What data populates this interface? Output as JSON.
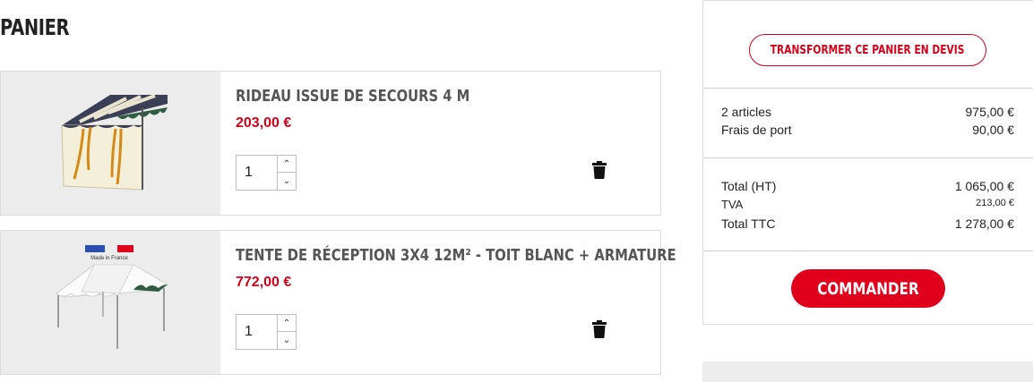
{
  "page": {
    "title": "PANIER"
  },
  "cart": {
    "items": [
      {
        "name": "RIDEAU ISSUE DE SECOURS 4 M",
        "price": "203,00 €",
        "quantity": "1",
        "image_icon": "curtain-tent-image",
        "delete_icon": "trash-icon"
      },
      {
        "name": "TENTE DE RÉCEPTION 3X4 12M² - TOIT BLANC + ARMATURE",
        "price": "772,00 €",
        "quantity": "1",
        "image_icon": "reception-tent-image",
        "badge_text": "Made in France",
        "delete_icon": "trash-icon"
      }
    ],
    "qty_up_glyph": "⌃",
    "qty_down_glyph": "⌄"
  },
  "summary": {
    "quote_button": "TRANSFORMER CE PANIER EN DEVIS",
    "articles_label": "2 articles",
    "articles_value": "975,00 €",
    "shipping_label": "Frais de port",
    "shipping_value": "90,00 €",
    "total_ht_label": "Total (HT)",
    "total_ht_value": "1 065,00 €",
    "tva_label": "TVA",
    "tva_value": "213,00 €",
    "total_ttc_label": "Total TTC",
    "total_ttc_value": "1 278,00 €",
    "order_button": "COMMANDER"
  },
  "colors": {
    "accent": "#e0001b",
    "price": "#d0021b",
    "image_bg": "#ececec"
  }
}
